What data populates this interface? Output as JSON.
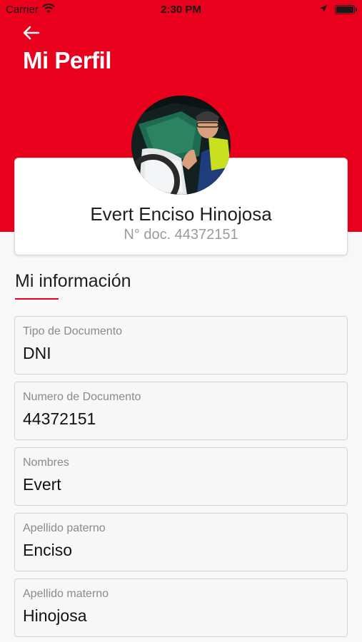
{
  "status_bar": {
    "carrier": "Carrier",
    "time": "2:30 PM"
  },
  "header": {
    "title": "Mi Perfil",
    "color": "#e8001c"
  },
  "profile": {
    "name": "Evert Enciso Hinojosa",
    "doc_text": "N° doc. 44372151"
  },
  "section": {
    "title": "Mi información"
  },
  "fields": [
    {
      "label": "Tipo de Documento",
      "value": "DNI"
    },
    {
      "label": "Numero de Documento",
      "value": "44372151"
    },
    {
      "label": "Nombres",
      "value": "Evert"
    },
    {
      "label": "Apellido paterno",
      "value": "Enciso"
    },
    {
      "label": "Apellido materno",
      "value": "Hinojosa"
    }
  ],
  "icons": {
    "back": "arrow-left-icon",
    "wifi": "wifi-icon",
    "location": "location-arrow-icon",
    "battery": "battery-icon"
  }
}
